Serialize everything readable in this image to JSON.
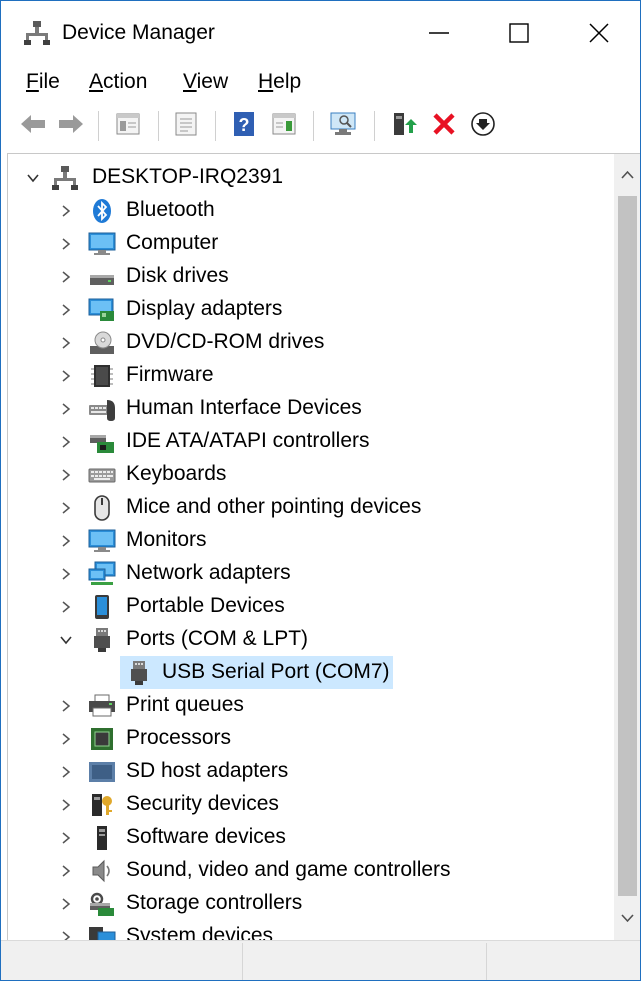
{
  "window": {
    "title": "Device Manager"
  },
  "menubar": {
    "items": [
      {
        "label": "File",
        "accesskey": "F",
        "rest": "ile"
      },
      {
        "label": "Action",
        "accesskey": "A",
        "rest": "ction"
      },
      {
        "label": "View",
        "accesskey": "V",
        "rest": "iew"
      },
      {
        "label": "Help",
        "accesskey": "H",
        "rest": "elp"
      }
    ]
  },
  "toolbar": {
    "buttons": [
      "back-icon",
      "forward-icon",
      "show-hide-console-tree-icon",
      "properties-icon",
      "help-icon",
      "show-action-pane-icon",
      "scan-hardware-changes-icon",
      "update-driver-icon",
      "uninstall-device-icon",
      "disable-device-icon"
    ]
  },
  "tree": {
    "root": {
      "label": "DESKTOP-IRQ2391",
      "expanded": true,
      "icon": "computer-tower-icon"
    },
    "items": [
      {
        "label": "Bluetooth",
        "icon": "bluetooth-icon",
        "expanded": false
      },
      {
        "label": "Computer",
        "icon": "monitor-icon",
        "expanded": false
      },
      {
        "label": "Disk drives",
        "icon": "disk-drive-icon",
        "expanded": false
      },
      {
        "label": "Display adapters",
        "icon": "display-adapter-icon",
        "expanded": false
      },
      {
        "label": "DVD/CD-ROM drives",
        "icon": "dvd-drive-icon",
        "expanded": false
      },
      {
        "label": "Firmware",
        "icon": "chip-icon",
        "expanded": false
      },
      {
        "label": "Human Interface Devices",
        "icon": "hid-icon",
        "expanded": false
      },
      {
        "label": "IDE ATA/ATAPI controllers",
        "icon": "ide-controller-icon",
        "expanded": false
      },
      {
        "label": "Keyboards",
        "icon": "keyboard-icon",
        "expanded": false
      },
      {
        "label": "Mice and other pointing devices",
        "icon": "mouse-icon",
        "expanded": false
      },
      {
        "label": "Monitors",
        "icon": "monitor-icon",
        "expanded": false
      },
      {
        "label": "Network adapters",
        "icon": "network-icon",
        "expanded": false
      },
      {
        "label": "Portable Devices",
        "icon": "portable-device-icon",
        "expanded": false
      },
      {
        "label": "Ports (COM & LPT)",
        "icon": "port-icon",
        "expanded": true,
        "children": [
          {
            "label": "USB Serial Port (COM7)",
            "icon": "port-icon",
            "selected": true
          }
        ]
      },
      {
        "label": "Print queues",
        "icon": "printer-icon",
        "expanded": false
      },
      {
        "label": "Processors",
        "icon": "processor-icon",
        "expanded": false
      },
      {
        "label": "SD host adapters",
        "icon": "sd-adapter-icon",
        "expanded": false
      },
      {
        "label": "Security devices",
        "icon": "security-device-icon",
        "expanded": false
      },
      {
        "label": "Software devices",
        "icon": "software-device-icon",
        "expanded": false
      },
      {
        "label": "Sound, video and game controllers",
        "icon": "speaker-icon",
        "expanded": false
      },
      {
        "label": "Storage controllers",
        "icon": "storage-controller-icon",
        "expanded": false
      },
      {
        "label": "System devices",
        "icon": "system-devices-icon",
        "expanded": false
      }
    ]
  },
  "colors": {
    "selection": "#cce8ff",
    "window_border": "#1f6fbf",
    "uninstall_red": "#e81123"
  }
}
